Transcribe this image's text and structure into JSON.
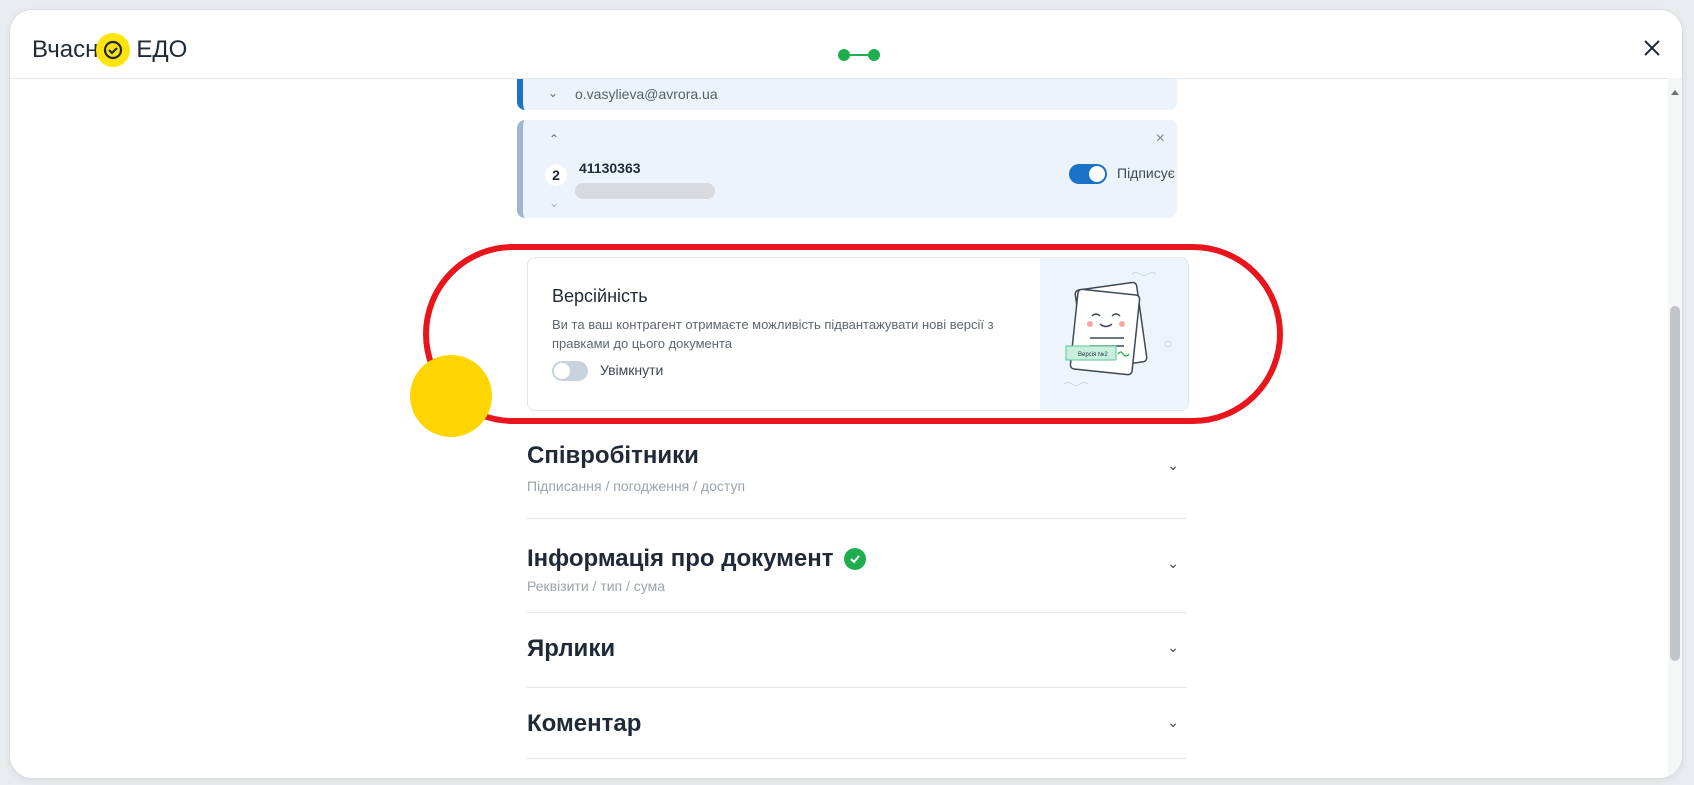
{
  "header": {
    "logo_left": "Вчасн",
    "logo_right": "ЕДО",
    "close_label": "×"
  },
  "prev_signer": {
    "email": "o.vasylieva@avrora.ua"
  },
  "signer": {
    "order": "2",
    "code": "41130363",
    "role_label": "Підписує",
    "remove_label": "×"
  },
  "versioning": {
    "title": "Версійність",
    "description": "Ви та ваш контрагент отримаєте можливість підвантажувати нові версії з правками до цього документа",
    "toggle_label": "Увімкнути",
    "illustration_tag": "Версія №2"
  },
  "sections": [
    {
      "title": "Співробітники",
      "subtitle": "Підписання / погодження / доступ"
    },
    {
      "title": "Інформація про документ",
      "subtitle": "Реквізити / тип / сума"
    },
    {
      "title": "Ярлики",
      "subtitle": ""
    },
    {
      "title": "Коментар",
      "subtitle": ""
    }
  ],
  "colors": {
    "accent_blue": "#1a73c7",
    "success_green": "#1fae4e",
    "highlight_red": "#e8161c",
    "brand_yellow": "#ffe40a"
  }
}
